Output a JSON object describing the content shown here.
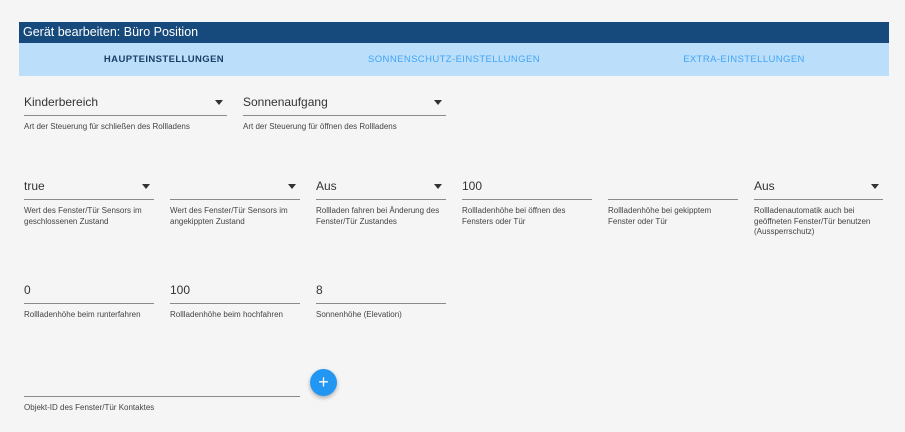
{
  "dialog": {
    "title": "Gerät bearbeiten: Büro Position"
  },
  "tabs": [
    {
      "label": "HAUPTEINSTELLUNGEN",
      "active": true
    },
    {
      "label": "SONNENSCHUTZ-EINSTELLUNGEN",
      "active": false
    },
    {
      "label": "EXTRA-EINSTELLUNGEN",
      "active": false
    }
  ],
  "fields": {
    "close_type": {
      "value": "Kinderbereich",
      "helper": "Art der Steuerung für schließen des Rollladens"
    },
    "open_type": {
      "value": "Sonnenaufgang",
      "helper": "Art der Steuerung für öffnen des Rollladens"
    },
    "sensor_closed": {
      "value": "true",
      "helper": "Wert des Fenster/Tür Sensors im geschlossenen Zustand"
    },
    "sensor_tilted": {
      "value": "",
      "helper": "Wert des Fenster/Tür Sensors im angekippten Zustand"
    },
    "move_on_change": {
      "value": "Aus",
      "helper": "Rollladen fahren bei Änderung des Fenster/Tür Zustandes"
    },
    "height_open_window": {
      "value": "100",
      "helper": "Rollladenhöhe bei öffnen des Fensters oder Tür"
    },
    "height_tilted": {
      "value": "",
      "helper": "Rollladenhöhe bei gekipptem Fenster oder Tür"
    },
    "lockout": {
      "value": "Aus",
      "helper": "Rollladenautomatik auch bei geöffneten Fenster/Tür benutzen (Aussperrschutz)"
    },
    "height_down": {
      "value": "0",
      "helper": "Rollladenhöhe beim runterfahren"
    },
    "height_up": {
      "value": "100",
      "helper": "Rollladenhöhe beim hochfahren"
    },
    "sun_elevation": {
      "value": "8",
      "helper": "Sonnenhöhe (Elevation)"
    },
    "contact_id": {
      "value": "",
      "helper": "Objekt-ID des Fenster/Tür Kontaktes"
    }
  },
  "add_button": {
    "icon": "plus-icon",
    "glyph": "+"
  },
  "colors": {
    "header": "#174a7c",
    "tabbar": "#bbdefb",
    "active_tab": "#1a3f66",
    "inactive_tab": "#42a5f5",
    "fab": "#2196f3"
  }
}
